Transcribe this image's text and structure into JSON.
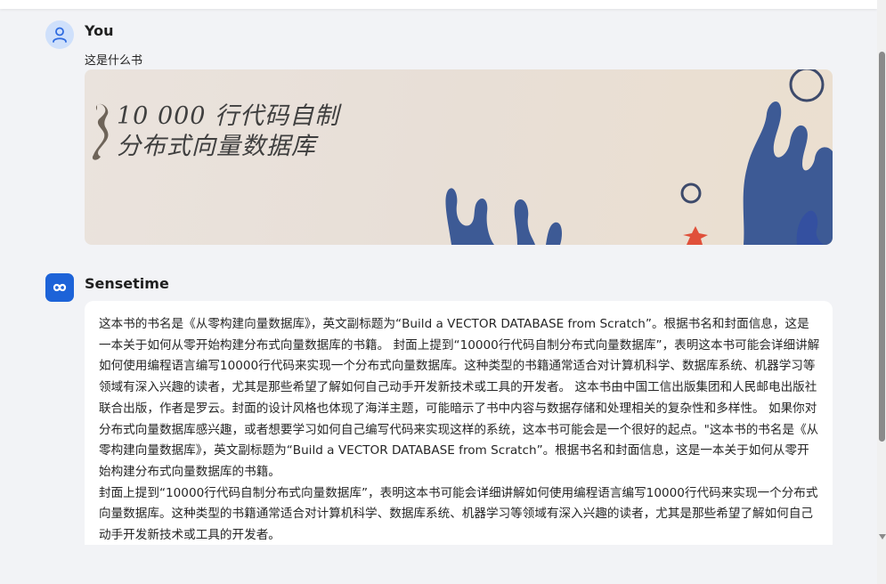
{
  "user": {
    "name": "You",
    "message": "这是什么书"
  },
  "book_cover": {
    "number": "10 000",
    "title_line1_rest": "行代码自制",
    "title_line2": "分布式向量数据库"
  },
  "bot": {
    "name": "Sensetime",
    "paragraph1": "这本书的书名是《从零构建向量数据库》，英文副标题为“Build a VECTOR DATABASE from Scratch”。根据书名和封面信息，这是一本关于如何从零开始构建分布式向量数据库的书籍。  封面上提到“10000行代码自制分布式向量数据库”，表明这本书可能会详细讲解如何使用编程语言编写10000行代码来实现一个分布式向量数据库。这种类型的书籍通常适合对计算机科学、数据库系统、机器学习等领域有深入兴趣的读者，尤其是那些希望了解如何自己动手开发新技术或工具的开发者。  这本书由中国工信出版集团和人民邮电出版社联合出版，作者是罗云。封面的设计风格也体现了海洋主题，可能暗示了书中内容与数据存储和处理相关的复杂性和多样性。  如果你对分布式向量数据库感兴趣，或者想要学习如何自己编写代码来实现这样的系统，这本书可能会是一个很好的起点。\"这本书的书名是《从零构建向量数据库》，英文副标题为“Build a VECTOR DATABASE from Scratch”。根据书名和封面信息，这是一本关于如何从零开始构建分布式向量数据库的书籍。",
    "paragraph2": "封面上提到“10000行代码自制分布式向量数据库”，表明这本书可能会详细讲解如何使用编程语言编写10000行代码来实现一个分布式向量数据库。这种类型的书籍通常适合对计算机科学、数据库系统、机器学习等领域有深入兴趣的读者，尤其是那些希望了解如何自己动手开发新技术或工具的开发者。"
  },
  "colors": {
    "coral_blue": "#3d5a95",
    "avatar_bot": "#1d63d8",
    "avatar_user_bg": "#cfe0fb",
    "starfish": "#e0503a"
  }
}
